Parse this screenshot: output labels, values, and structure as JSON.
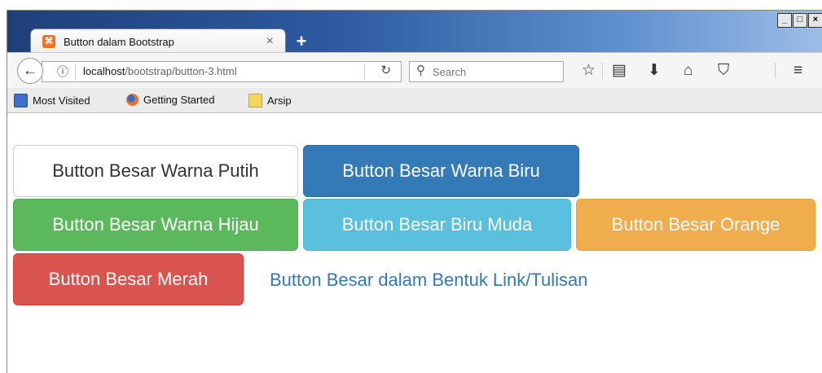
{
  "browser": {
    "tab_title": "Button dalam Bootstrap",
    "tab_close": "×",
    "new_tab": "+",
    "window_controls": [
      "_",
      "□",
      "×"
    ],
    "url_host": "localhost",
    "url_path": "/bootstrap/button-3.html",
    "search_placeholder": "Search",
    "bookmarks": [
      "Most Visited",
      "Getting Started",
      "Arsip"
    ]
  },
  "icons": {
    "tab": "xampp-icon",
    "back": "back-arrow-icon",
    "info": "info-icon",
    "reload": "reload-icon",
    "search": "search-icon",
    "bookmark_star": "star-icon",
    "reading_list": "clipboard-icon",
    "downloads": "download-icon",
    "home": "home-icon",
    "pocket": "pocket-icon",
    "menu": "hamburger-menu-icon"
  },
  "buttons": {
    "putih": "Button Besar Warna Putih",
    "biru": "Button Besar Warna Biru",
    "hijau": "Button Besar Warna Hijau",
    "biru_muda": "Button Besar Biru Muda",
    "orange": "Button Besar Orange",
    "merah": "Button Besar Merah",
    "link": "Button Besar dalam Bentuk Link/Tulisan"
  },
  "colors": {
    "primary": "#337ab7",
    "success": "#5cb85c",
    "info": "#5bc0de",
    "warning": "#f0ad4e",
    "danger": "#d9534f",
    "default": "#ffffff"
  }
}
